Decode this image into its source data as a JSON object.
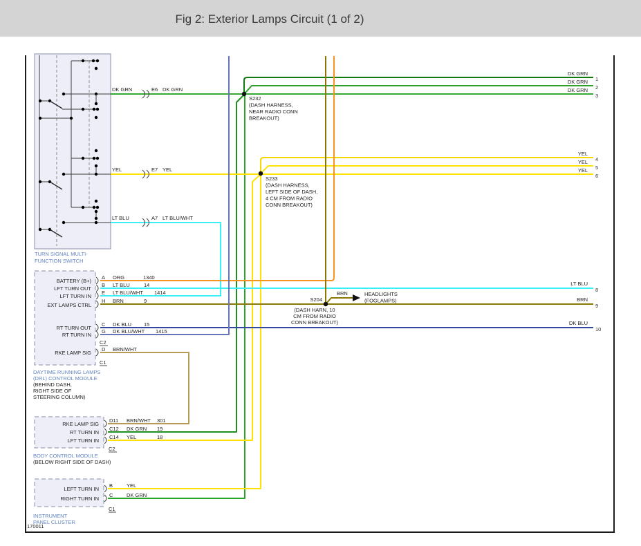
{
  "title": "Fig 2: Exterior Lamps Circuit (1 of 2)",
  "doc_number": "170011",
  "colors": {
    "dk_grn_dark": "#117911",
    "dk_grn": "#2DA02D",
    "dk_grn_light": "#4CBC4C",
    "yel": "#FFE205",
    "lt_blu": "#3AEFF5",
    "org": "#F79420",
    "brn": "#8A7600",
    "brn_wht": "#B59B55",
    "dk_blu": "#33479E",
    "dk_blu_wht": "#6674B8",
    "label_blue": "#5F83C0",
    "titlebar_bg": "#D4D4D4"
  },
  "switch": {
    "name": [
      "TURN SIGNAL MULTI-",
      "FUNCTION SWITCH"
    ],
    "outputs": [
      {
        "wire": "DK GRN",
        "pin": "E6",
        "wire_out": "DK GRN"
      },
      {
        "wire": "YEL",
        "pin": "E7",
        "wire_out": "YEL"
      },
      {
        "wire": "LT BLU",
        "pin": "A7",
        "wire_out": "LT BLU/WHT"
      }
    ]
  },
  "splices": {
    "s232": {
      "id": "S232",
      "note": [
        "(DASH HARNESS,",
        "NEAR RADIO CONN",
        "BREAKOUT)"
      ]
    },
    "s233": {
      "id": "S233",
      "note": [
        "(DASH HARNESS,",
        "LEFT SIDE OF DASH,",
        "4 CM FROM RADIO",
        "CONN BREAKOUT)"
      ]
    },
    "s204": {
      "id": "S204",
      "note": [
        "(DASH HARN, 10",
        "CM FROM RADIO",
        "CONN BREAKOUT)"
      ]
    }
  },
  "branch": {
    "wire": "BRN",
    "dest": [
      "HEADLIGHTS",
      "(FOGLAMPS)"
    ]
  },
  "drl": {
    "pins": [
      {
        "label": "BATTERY (B+)",
        "pin": "A",
        "wire": "ORG",
        "ckt": "1340"
      },
      {
        "label": "LFT TURN OUT",
        "pin": "B",
        "wire": "LT BLU",
        "ckt": "14"
      },
      {
        "label": "LFT TURN IN",
        "pin": "E",
        "wire": "LT BLU/WHT",
        "ckt": "1414"
      },
      {
        "label": "EXT LAMPS CTRL",
        "pin": "H",
        "wire": "BRN",
        "ckt": "9"
      },
      {
        "label": "RT TURN OUT",
        "pin": "C",
        "wire": "DK BLU",
        "ckt": "15"
      },
      {
        "label": "RT TURN IN",
        "pin": "G",
        "wire": "DK BLU/WHT",
        "ckt": "1415"
      },
      {
        "label": "RKE LAMP SIG",
        "pin": "D",
        "wire": "BRN/WHT",
        "ckt": ""
      }
    ],
    "c2": "C2",
    "c1": "C1",
    "name": [
      "DAYTIME RUNNING LAMPS",
      "(DRL) CONTROL MODULE"
    ],
    "loc": [
      "(BEHIND DASH,",
      "RIGHT SIDE OF",
      "STEERING COLUMN)"
    ]
  },
  "bcm": {
    "pins": [
      {
        "label": "RKE LAMP SIG",
        "pin": "D11",
        "wire": "BRN/WHT",
        "ckt": "301"
      },
      {
        "label": "RT TURN IN",
        "pin": "C12",
        "wire": "DK GRN",
        "ckt": "19"
      },
      {
        "label": "LFT TURN IN",
        "pin": "C14",
        "wire": "YEL",
        "ckt": "18"
      }
    ],
    "c2": "C2",
    "name": [
      "BODY CONTROL MODULE"
    ],
    "loc": [
      "(BELOW RIGHT SIDE OF DASH)"
    ]
  },
  "cluster": {
    "pins": [
      {
        "label": "LEFT TURN IN",
        "pin": "B",
        "wire": "YEL",
        "ckt": ""
      },
      {
        "label": "RIGHT TURN IN",
        "pin": "C",
        "wire": "DK GRN",
        "ckt": ""
      }
    ],
    "c1": "C1",
    "name": [
      "INSTRUMENT",
      "PANEL CLUSTER"
    ]
  },
  "terminals": [
    {
      "num": "1",
      "wire": "DK GRN"
    },
    {
      "num": "2",
      "wire": "DK GRN"
    },
    {
      "num": "3",
      "wire": "DK GRN"
    },
    {
      "num": "4",
      "wire": "YEL"
    },
    {
      "num": "5",
      "wire": "YEL"
    },
    {
      "num": "6",
      "wire": "YEL"
    },
    {
      "num": "8",
      "wire": "LT BLU"
    },
    {
      "num": "9",
      "wire": "BRN"
    },
    {
      "num": "10",
      "wire": "DK BLU"
    }
  ]
}
